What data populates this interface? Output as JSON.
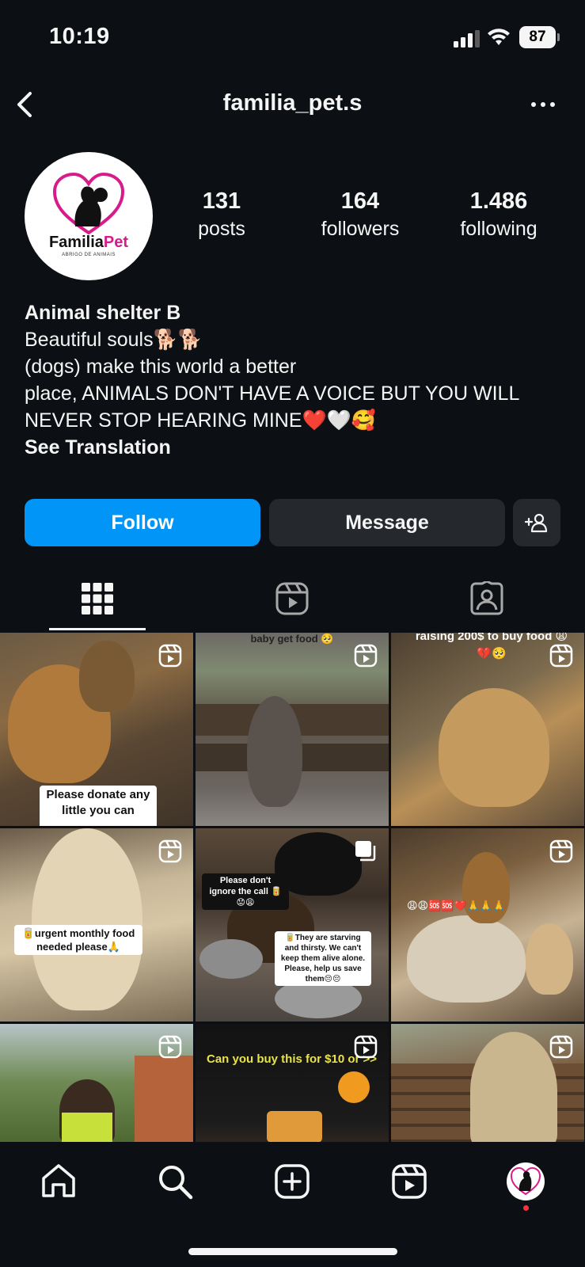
{
  "status_bar": {
    "time": "10:19",
    "battery": "87"
  },
  "header": {
    "username": "familia_pet.s"
  },
  "profile": {
    "logo_brand_1": "Familia",
    "logo_brand_2": "Pet",
    "logo_subtitle": "ABRIGO DE ANIMAIS",
    "stats": [
      {
        "value": "131",
        "label": "posts"
      },
      {
        "value": "164",
        "label": "followers"
      },
      {
        "value": "1.486",
        "label": "following"
      }
    ],
    "name": "Animal shelter B",
    "bio_lines": [
      "Beautiful souls🐕🐕",
      "(dogs) make this world a better",
      "place, ANIMALS DON'T HAVE A VOICE BUT YOU WILL",
      "NEVER STOP HEARING MINE❤️🤍🥰"
    ],
    "see_translation": "See Translation"
  },
  "actions": {
    "follow": "Follow",
    "message": "Message"
  },
  "tabs": [
    "grid-icon",
    "reels-icon",
    "tagged-icon"
  ],
  "posts": [
    {
      "caption": "Please donate any little you can",
      "type": "reel"
    },
    {
      "caption": "baby get food 🥺",
      "type": "reel"
    },
    {
      "caption": "raising 200$ to buy food 😩💔🥺",
      "type": "reel"
    },
    {
      "caption": "🥫urgent monthly food needed please🙏",
      "type": "reel"
    },
    {
      "caption_1": "Please don't ignore the call 🥫😟😩",
      "caption_2": "🥫They are starving and thirsty. We can't keep them alive alone. Please, help us save them😔😔",
      "type": "carousel"
    },
    {
      "caption": "😩😩🆘🆘❤️🙏🙏🙏",
      "type": "reel"
    },
    {
      "caption": "",
      "type": "reel"
    },
    {
      "caption": "Can you buy this for $10 or >>",
      "type": "reel"
    },
    {
      "caption": "",
      "type": "reel"
    }
  ],
  "colors": {
    "background": "#0c1014",
    "follow_button": "#0095f6",
    "secondary_button": "#25292e",
    "notification_dot": "#ff3040",
    "brand_pink": "#d81b8a"
  }
}
